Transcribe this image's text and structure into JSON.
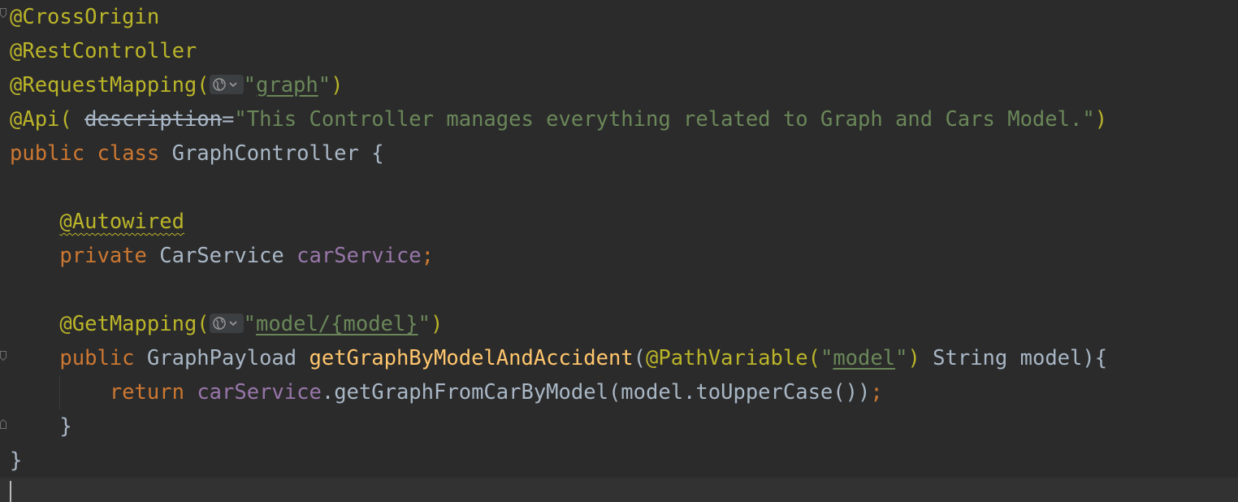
{
  "editor": {
    "lines": [
      [
        {
          "t": "@CrossOrigin",
          "c": "ann"
        }
      ],
      [
        {
          "t": "@RestController",
          "c": "ann"
        }
      ],
      [
        {
          "t": "@RequestMapping(",
          "c": "ann"
        },
        {
          "t": "globe-icon",
          "c": "icon"
        },
        {
          "t": "\"",
          "c": "str"
        },
        {
          "t": "graph",
          "c": "str ul"
        },
        {
          "t": "\"",
          "c": "str"
        },
        {
          "t": ")",
          "c": "ann"
        }
      ],
      [
        {
          "t": "@Api(",
          "c": "ann"
        },
        {
          "t": " ",
          "c": "plain"
        },
        {
          "t": "description",
          "c": "param-name"
        },
        {
          "t": "=",
          "c": "plain"
        },
        {
          "t": "\"This Controller manages everything related to Graph and Cars Model.\"",
          "c": "str"
        },
        {
          "t": ")",
          "c": "ann"
        }
      ],
      [
        {
          "t": "public",
          "c": "kw"
        },
        {
          "t": " ",
          "c": "plain"
        },
        {
          "t": "class",
          "c": "kw"
        },
        {
          "t": " GraphController {",
          "c": "plain"
        }
      ],
      [],
      [
        {
          "t": "    ",
          "c": "plain"
        },
        {
          "t": "@Autowired",
          "c": "ann squiggle"
        }
      ],
      [
        {
          "t": "    ",
          "c": "plain"
        },
        {
          "t": "private",
          "c": "kw"
        },
        {
          "t": " CarService ",
          "c": "plain"
        },
        {
          "t": "carService",
          "c": "field"
        },
        {
          "t": ";",
          "c": "kw"
        }
      ],
      [],
      [
        {
          "t": "    ",
          "c": "plain"
        },
        {
          "t": "@GetMapping(",
          "c": "ann"
        },
        {
          "t": "globe-icon",
          "c": "icon"
        },
        {
          "t": "\"",
          "c": "str"
        },
        {
          "t": "model/",
          "c": "str ul"
        },
        {
          "t": "{model}",
          "c": "str ul"
        },
        {
          "t": "\"",
          "c": "str"
        },
        {
          "t": ")",
          "c": "ann"
        }
      ],
      [
        {
          "t": "    ",
          "c": "plain"
        },
        {
          "t": "public",
          "c": "kw"
        },
        {
          "t": " GraphPayload ",
          "c": "plain"
        },
        {
          "t": "getGraphByModelAndAccident",
          "c": "method"
        },
        {
          "t": "(",
          "c": "plain"
        },
        {
          "t": "@PathVariable(",
          "c": "ann"
        },
        {
          "t": "\"",
          "c": "str"
        },
        {
          "t": "model",
          "c": "str ul"
        },
        {
          "t": "\"",
          "c": "str"
        },
        {
          "t": ")",
          "c": "ann"
        },
        {
          "t": " String model){",
          "c": "plain"
        }
      ],
      [
        {
          "t": "        ",
          "c": "plain"
        },
        {
          "t": "return",
          "c": "kw"
        },
        {
          "t": " ",
          "c": "plain"
        },
        {
          "t": "carService",
          "c": "field"
        },
        {
          "t": ".getGraphFromCarByModel(model.toUpperCase())",
          "c": "plain"
        },
        {
          "t": ";",
          "c": "kw"
        }
      ],
      [
        {
          "t": "    }",
          "c": "plain"
        }
      ],
      [
        {
          "t": "}",
          "c": "plain"
        }
      ]
    ]
  },
  "colors": {
    "background": "#2b2b2b",
    "annotation": "#bbb529",
    "keyword": "#cc7832",
    "string": "#6a8759",
    "field": "#9876aa",
    "method": "#ffc66d",
    "text": "#a9b7c6"
  }
}
